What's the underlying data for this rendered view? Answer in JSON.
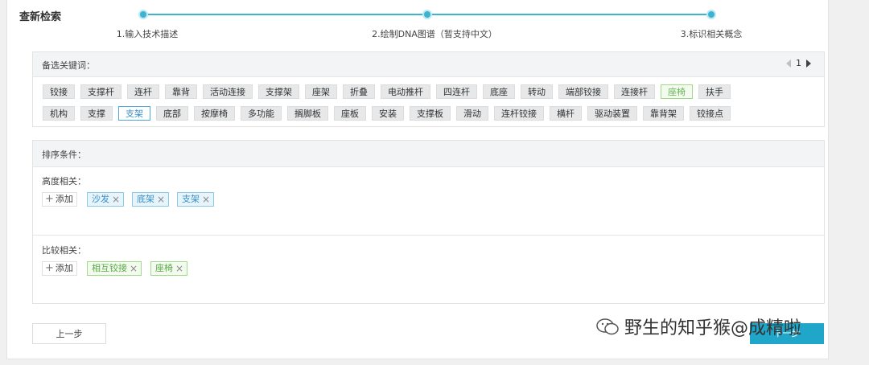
{
  "page_title": "查新检索",
  "steps": [
    {
      "label": "1.输入技术描述"
    },
    {
      "label": "2.绘制DNA图谱（暂支持中文）"
    },
    {
      "label": "3.标识相关概念"
    }
  ],
  "keywords": {
    "title": "备选关键词：",
    "page": "1",
    "row1": [
      "铰接",
      "支撑杆",
      "连杆",
      "靠背",
      "活动连接",
      "支撑架",
      "座架",
      "折叠",
      "电动推杆",
      "四连杆",
      "底座",
      "转动",
      "端部铰接",
      "连接杆",
      "座椅",
      "扶手"
    ],
    "row2": [
      "机构",
      "支撑",
      "支架",
      "底部",
      "按摩椅",
      "多功能",
      "搁脚板",
      "座板",
      "安装",
      "支撑板",
      "滑动",
      "连杆铰接",
      "横杆",
      "驱动装置",
      "靠背架",
      "铰接点"
    ]
  },
  "sort": {
    "title": "排序条件：",
    "height_group": {
      "label": "高度相关：",
      "add_label": "添加",
      "tags": [
        "沙发",
        "底架",
        "支架"
      ]
    },
    "compare_group": {
      "label": "比较相关：",
      "add_label": "添加",
      "tags": [
        "相互铰接",
        "座椅"
      ]
    }
  },
  "buttons": {
    "prev": "上一步",
    "next": "下一步"
  },
  "watermark": "野生的知乎猴@成精啦",
  "colors": {
    "accent": "#1fa6c9",
    "step_line": "#3bb4d2",
    "tag_blue": "#3a8fc8",
    "tag_green": "#6ab45a"
  }
}
